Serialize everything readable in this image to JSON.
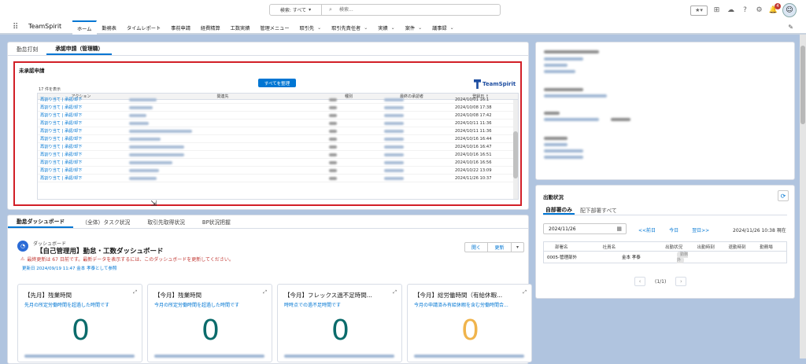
{
  "header": {
    "search_scope": "検索: すべて",
    "search_placeholder": "検索...",
    "notification_count": "4"
  },
  "nav": {
    "app_name": "TeamSpirit",
    "items": [
      {
        "label": "ホーム",
        "dropdown": false,
        "active": true
      },
      {
        "label": "勤務表",
        "dropdown": false
      },
      {
        "label": "タイムレポート",
        "dropdown": false
      },
      {
        "label": "事前申請",
        "dropdown": false
      },
      {
        "label": "経費精算",
        "dropdown": false
      },
      {
        "label": "工数実績",
        "dropdown": false
      },
      {
        "label": "管理メニュー",
        "dropdown": false
      },
      {
        "label": "取引先",
        "dropdown": true
      },
      {
        "label": "取引先責任者",
        "dropdown": true
      },
      {
        "label": "実績",
        "dropdown": true
      },
      {
        "label": "案件",
        "dropdown": true
      },
      {
        "label": "議事録",
        "dropdown": true
      }
    ]
  },
  "approval_panel": {
    "tabs": [
      "勤怠打刻",
      "承認申請（管理職）"
    ],
    "section_title": "未承認申請",
    "approve_all": "すべてを整理",
    "logo_text": "TeamSpirit",
    "count_label": "17 件を表示",
    "columns": [
      "アクション",
      "関連先",
      "種別",
      "最終の承認者",
      "登録日 ↑"
    ],
    "row_action": "再割り当て | 承認/却下",
    "rows": [
      "2024/10/01 16:1",
      "2024/10/08 17:38",
      "2024/10/08 17:42",
      "2024/10/11 11:36",
      "2024/10/11 11:36",
      "2024/10/16 16:44",
      "2024/10/16 16:47",
      "2024/10/16 16:51",
      "2024/10/16 16:56",
      "2024/10/22 13:09",
      "2024/11/26 10:37"
    ]
  },
  "dashboard": {
    "tabs": [
      "勤怠ダッシュボード",
      "（全体）タスク状況",
      "取引先取得状況",
      "BP状況把握"
    ],
    "subtitle": "ダッシュボード",
    "title": "【自己管理用】勤怠・工数ダッシュボード",
    "warning": "最終更新は 67 日前です。最新データを表示するには、このダッシュボードを更新してください。",
    "updated": "更新日 2024/09/19 11:47 金本 孝泰として参照",
    "btn_open": "開く",
    "btn_refresh": "更新",
    "cards": [
      {
        "title": "【先月】残業時間",
        "sub": "先月の所定労働時間を超過した時間です",
        "value": "0",
        "color": "#0b6b6b"
      },
      {
        "title": "【今月】残業時間",
        "sub": "今月の所定労働時間を超過した時間です",
        "value": "0",
        "color": "#0b6b6b"
      },
      {
        "title": "【今月】フレックス過不足時間...",
        "sub": "時時点での過不足時間です",
        "value": "0",
        "color": "#0b6b6b"
      },
      {
        "title": "【今月】総労働時間（有給休暇...",
        "sub": "今月の申請済み有給休暇を含む労働時間合...",
        "value": "0",
        "color": "#f0b44c"
      }
    ]
  },
  "attendance": {
    "title": "出勤状況",
    "tabs": [
      "自部署のみ",
      "配下部署すべて"
    ],
    "date": "2024/11/26",
    "prev": "<<前日",
    "today": "今日",
    "next": "翌日>>",
    "timestamp": "2024/11/26 10:38 現在",
    "columns": [
      "部署名",
      "社員名",
      "出勤状況",
      "出勤時刻",
      "退勤時刻",
      "勤務場"
    ],
    "row": {
      "dept": "0005-管理部外",
      "name": "金本 孝泰",
      "status": "勤務外"
    },
    "pager": "(1/1)"
  }
}
